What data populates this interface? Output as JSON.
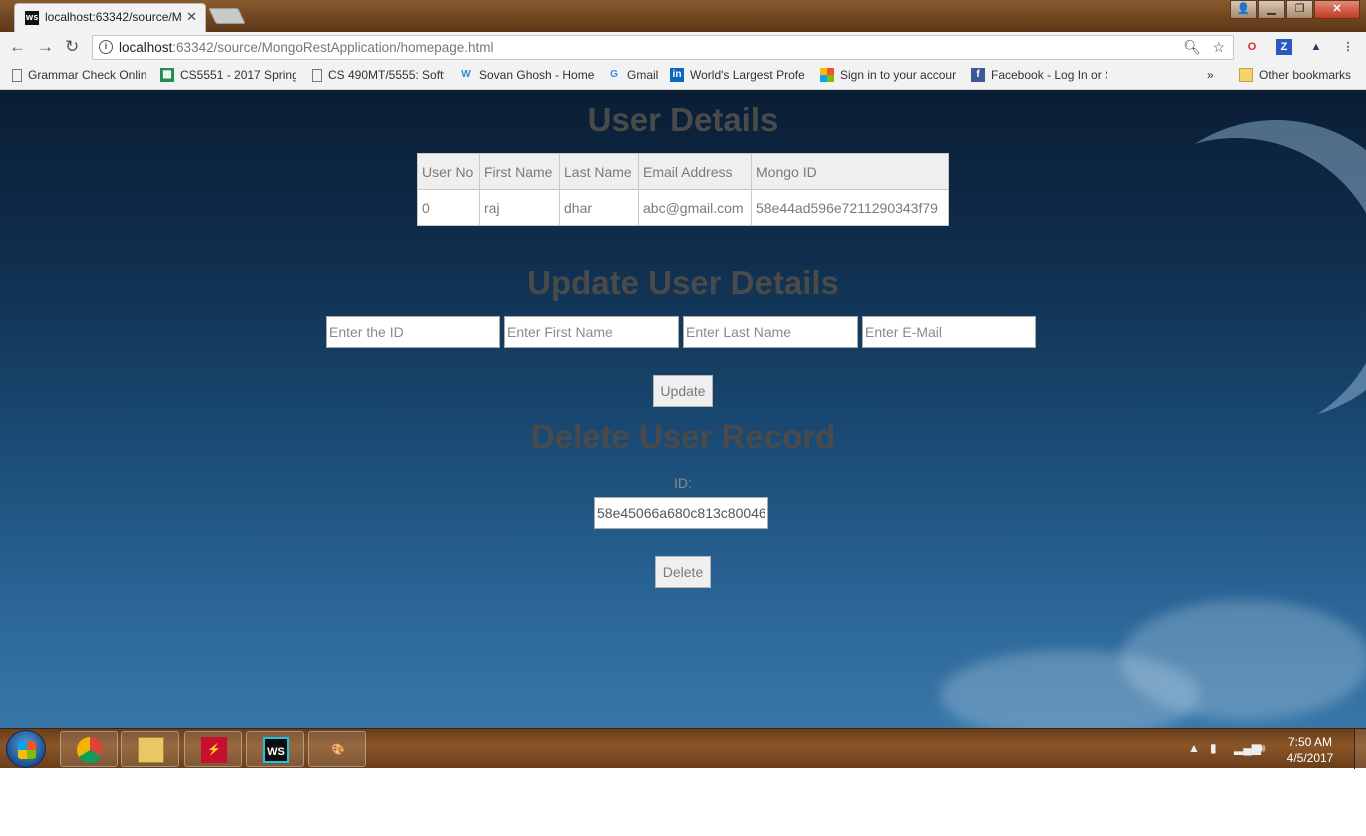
{
  "browser": {
    "tab_title": "localhost:63342/source/M",
    "favicon_text": "WS",
    "url_host": "localhost",
    "url_rest": ":63342/source/MongoRestApplication/homepage.html",
    "bookmarks": [
      {
        "label": "Grammar Check Onlin",
        "icon": "page-icon"
      },
      {
        "label": "CS5551 - 2017 Spring",
        "icon": "sheets-icon"
      },
      {
        "label": "CS 490MT/5555: Softw",
        "icon": "page-icon"
      },
      {
        "label": "Sovan Ghosh - Home",
        "icon": "weebly-icon"
      },
      {
        "label": "Gmail",
        "icon": "google-icon"
      },
      {
        "label": "World's Largest Profe",
        "icon": "linkedin-icon"
      },
      {
        "label": "Sign in to your accour",
        "icon": "microsoft-icon"
      },
      {
        "label": "Facebook - Log In or S",
        "icon": "facebook-icon"
      }
    ],
    "overflow_label": "»",
    "other_bookmarks": "Other bookmarks"
  },
  "page": {
    "user_details_title": "User Details",
    "table": {
      "headers": [
        "User No",
        "First Name",
        "Last Name",
        "Email Address",
        "Mongo ID"
      ],
      "rows": [
        [
          "0",
          "raj",
          "dhar",
          "abc@gmail.com",
          "58e44ad596e7211290343f79"
        ]
      ]
    },
    "update_title": "Update User Details",
    "update_fields": {
      "id_placeholder": "Enter the ID",
      "first_placeholder": "Enter First Name",
      "last_placeholder": "Enter Last Name",
      "email_placeholder": "Enter E-Mail"
    },
    "update_button": "Update",
    "delete_title": "Delete User Record",
    "delete_id_label": "ID:",
    "delete_id_value": "58e45066a680c813c80046",
    "delete_button": "Delete"
  },
  "taskbar": {
    "time": "7:50 AM",
    "date": "4/5/2017",
    "apps": [
      "chrome-icon",
      "file-explorer-icon",
      "pdf-app-icon",
      "webstorm-icon",
      "paint-icon"
    ]
  },
  "colors": {
    "heading": "#4a4a4a",
    "sky_top": "#0a1e34",
    "sky_bottom": "#3977a8",
    "taskbar": "#8a5527"
  }
}
